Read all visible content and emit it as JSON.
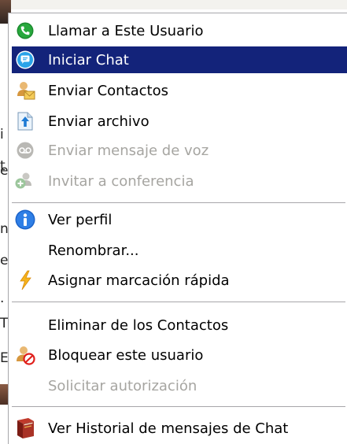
{
  "background": {
    "top_text": "...",
    "left_chars": [
      "i",
      "t",
      "e",
      "n",
      "e",
      ".",
      "T",
      "E"
    ]
  },
  "menu": {
    "items": [
      {
        "label": "Llamar a Este Usuario",
        "icon": "phone-icon",
        "state": "normal"
      },
      {
        "label": "Iniciar Chat",
        "icon": "chat-bubble-icon",
        "state": "selected"
      },
      {
        "label": "Enviar Contactos",
        "icon": "send-contacts-icon",
        "state": "normal"
      },
      {
        "label": "Enviar archivo",
        "icon": "send-file-icon",
        "state": "normal"
      },
      {
        "label": "Enviar mensaje de voz",
        "icon": "voicemail-icon",
        "state": "disabled"
      },
      {
        "label": "Invitar a conferencia",
        "icon": "conference-icon",
        "state": "disabled"
      },
      {
        "label": "Ver perfil",
        "icon": "info-icon",
        "state": "normal"
      },
      {
        "label": "Renombrar...",
        "icon": "",
        "state": "normal"
      },
      {
        "label": "Asignar marcación rápida",
        "icon": "lightning-icon",
        "state": "normal"
      },
      {
        "label": "Eliminar de los Contactos",
        "icon": "",
        "state": "normal"
      },
      {
        "label": "Bloquear este usuario",
        "icon": "block-user-icon",
        "state": "normal"
      },
      {
        "label": "Solicitar autorización",
        "icon": "",
        "state": "disabled"
      },
      {
        "label": "Ver Historial de mensajes de Chat",
        "icon": "history-book-icon",
        "state": "normal"
      }
    ]
  },
  "colors": {
    "selection": "#13237a",
    "disabled_text": "#a6a5a1",
    "separator": "#a7a6aa"
  }
}
